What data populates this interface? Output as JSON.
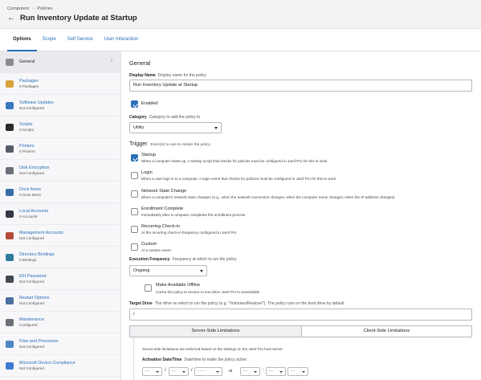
{
  "header": {
    "breadcrumb": [
      "Computers",
      "Policies"
    ],
    "title": "Run Inventory Update at Startup"
  },
  "tabs": [
    "Options",
    "Scope",
    "Self Service",
    "User Interaction"
  ],
  "sidebar": {
    "items": [
      {
        "label": "General",
        "sub": "",
        "icon": "general-icon",
        "color": "#8a8a92"
      },
      {
        "label": "Packages",
        "sub": "0 Packages",
        "icon": "package-icon",
        "color": "#d9a03a"
      },
      {
        "label": "Software Updates",
        "sub": "Not Configured",
        "icon": "software-update-icon",
        "color": "#3a78c0"
      },
      {
        "label": "Scripts",
        "sub": "0 Scripts",
        "icon": "script-icon",
        "color": "#2b2b2b"
      },
      {
        "label": "Printers",
        "sub": "0 Printers",
        "icon": "printer-icon",
        "color": "#555c66"
      },
      {
        "label": "Disk Encryption",
        "sub": "Not Configured",
        "icon": "disk-encryption-icon",
        "color": "#6a6f78"
      },
      {
        "label": "Dock Items",
        "sub": "0 Dock Items",
        "icon": "dock-icon",
        "color": "#3a6fa8"
      },
      {
        "label": "Local Accounts",
        "sub": "0 Accounts",
        "icon": "local-account-icon",
        "color": "#333a44"
      },
      {
        "label": "Management Accounts",
        "sub": "Not Configured",
        "icon": "management-account-icon",
        "color": "#b54a3a"
      },
      {
        "label": "Directory Bindings",
        "sub": "0 Bindings",
        "icon": "directory-icon",
        "color": "#2f7d9a"
      },
      {
        "label": "EFI Password",
        "sub": "Not Configured",
        "icon": "efi-icon",
        "color": "#444a52"
      },
      {
        "label": "Restart Options",
        "sub": "Not Configured",
        "icon": "restart-icon",
        "color": "#4a6fa0"
      },
      {
        "label": "Maintenance",
        "sub": "Configured",
        "icon": "maintenance-icon",
        "color": "#6b7078"
      },
      {
        "label": "Files and Processes",
        "sub": "Not Configured",
        "icon": "files-processes-icon",
        "color": "#4c86c6"
      },
      {
        "label": "Microsoft Device Compliance",
        "sub": "Not Configured",
        "icon": "microsoft-compliance-icon",
        "color": "#3d7bd1"
      }
    ]
  },
  "general": {
    "section_title": "General",
    "display_name_label": "Display Name",
    "display_name_desc": "Display name for the policy",
    "display_name_value": "Run Inventory Update at Startup",
    "enabled_label": "Enabled",
    "category_label": "Category",
    "category_desc": "Category to add the policy to",
    "category_value": "Utility",
    "trigger_title": "Trigger",
    "trigger_desc": "Event(s) to use to initiate the policy",
    "triggers": [
      {
        "label": "Startup",
        "desc": "When a computer starts up. A startup script that checks for policies must be configured in Jamf Pro for this to work",
        "checked": true
      },
      {
        "label": "Login",
        "desc": "When a user logs in to a computer. A login event that checks for policies must be configured in Jamf Pro for this to work",
        "checked": false
      },
      {
        "label": "Network State Change",
        "desc": "When a computer's network state changes (e.g., when the network connection changes, when the computer name changes, when the IP address changes)",
        "checked": false
      },
      {
        "label": "Enrollment Complete",
        "desc": "Immediately after a computer completes the enrollment process",
        "checked": false
      },
      {
        "label": "Recurring Check-in",
        "desc": "At the recurring check-in frequency configured in Jamf Pro",
        "checked": false
      },
      {
        "label": "Custom",
        "desc": "At a custom event",
        "checked": false
      }
    ],
    "exec_freq_label": "Execution Frequency",
    "exec_freq_desc": "Frequency at which to run the policy",
    "exec_freq_value": "Ongoing",
    "offline_label": "Make Available Offline",
    "offline_desc": "Cache the policy to ensure it runs when Jamf Pro is unavailable",
    "target_drive_label": "Target Drive",
    "target_drive_desc": "The drive on which to run the policy (e.g. \"/Volumes/Restore/\"). The policy runs on the boot drive by default",
    "target_drive_value": "/",
    "seg_server": "Server-Side Limitations",
    "seg_client": "Client-Side Limitations",
    "server_note": "Server-side limitations are enforced based on the settings on the Jamf Pro host server",
    "activation_label": "Activation Date/Time",
    "activation_desc": "Date/time to make the policy active",
    "date_mm": "- -",
    "date_dd": "- -",
    "date_yyyy": "- - - -",
    "at_label": "at",
    "time_hh": "- -",
    "time_mm": "- -",
    "time_ampm": "- -"
  }
}
